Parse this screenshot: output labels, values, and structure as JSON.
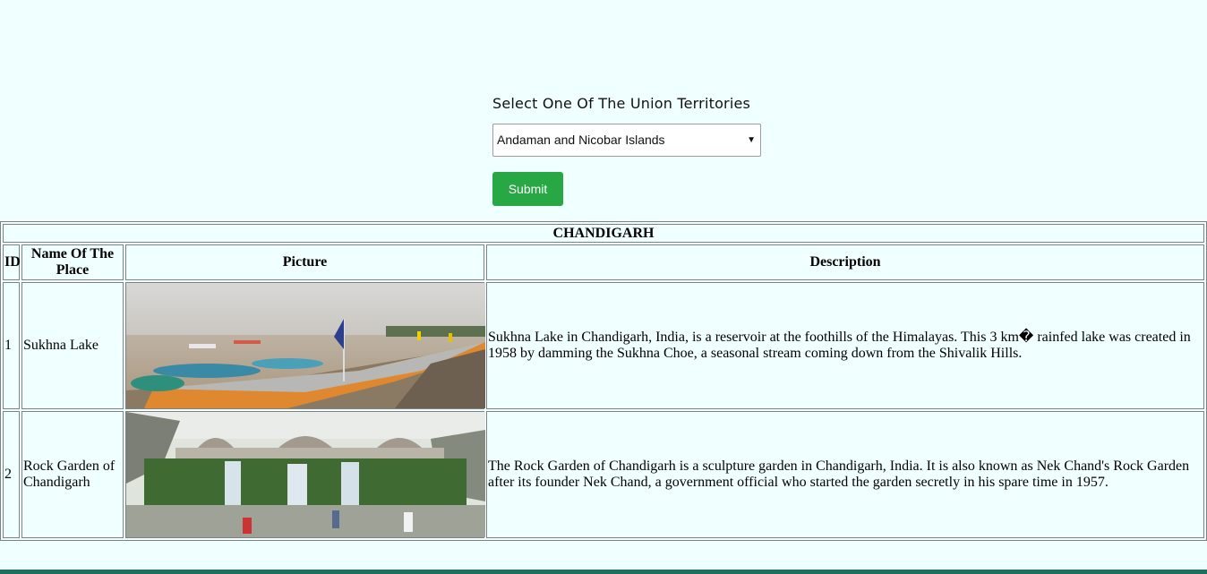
{
  "form": {
    "label": "Select One Of The Union Territories",
    "selected_value": "Andaman and Nicobar Islands",
    "submit_label": "Submit"
  },
  "table": {
    "caption": "CHANDIGARH",
    "headers": {
      "id": "ID",
      "name": "Name Of The Place",
      "picture": "Picture",
      "description": "Description"
    },
    "rows": [
      {
        "id": "1",
        "name": "Sukhna Lake",
        "description": "Sukhna Lake in Chandigarh, India, is a reservoir at the foothills of the Himalayas. This 3 km� rainfed lake was created in 1958 by damming the Sukhna Choe, a seasonal stream coming down from the Shivalik Hills."
      },
      {
        "id": "2",
        "name": "Rock Garden of Chandigarh",
        "description": "The Rock Garden of Chandigarh is a sculpture garden in Chandigarh, India. It is also known as Nek Chand's Rock Garden after its founder Nek Chand, a government official who started the garden secretly in his spare time in 1957."
      }
    ]
  },
  "colors": {
    "page_background": "#f0ffff",
    "submit_button": "#28a745"
  }
}
